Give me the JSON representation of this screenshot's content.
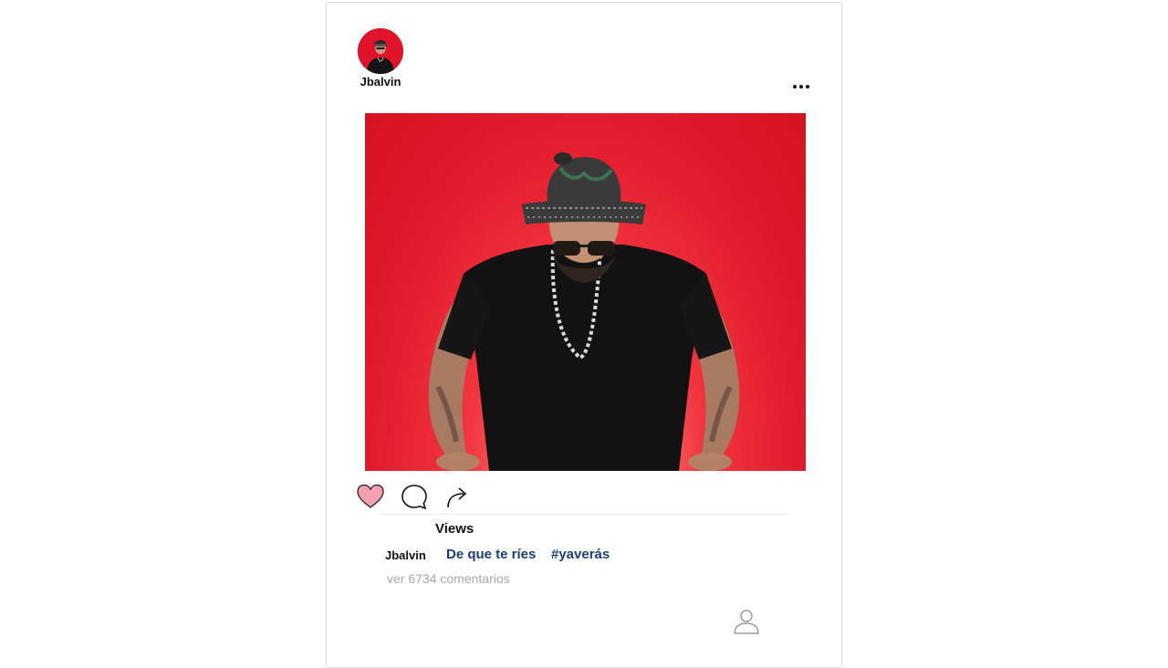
{
  "post": {
    "username": "Jbalvin",
    "menu_icon": "ellipsis-icon",
    "actions": {
      "like_icon": "heart-icon",
      "comment_icon": "comment-bubble-icon",
      "share_icon": "share-arrow-icon",
      "liked": true
    },
    "views_label": "Views",
    "caption": {
      "username": "Jbalvin",
      "text": "De que te ríes",
      "hashtag": "#yaverás"
    },
    "comments_link": "ver 6734 comentarios",
    "profile_icon": "user-outline-icon"
  },
  "colors": {
    "photo_background": "#e0132a",
    "heart_fill": "#f4a0ae",
    "caption_blue": "#1b3e78",
    "muted_text": "#a8a8a8"
  }
}
